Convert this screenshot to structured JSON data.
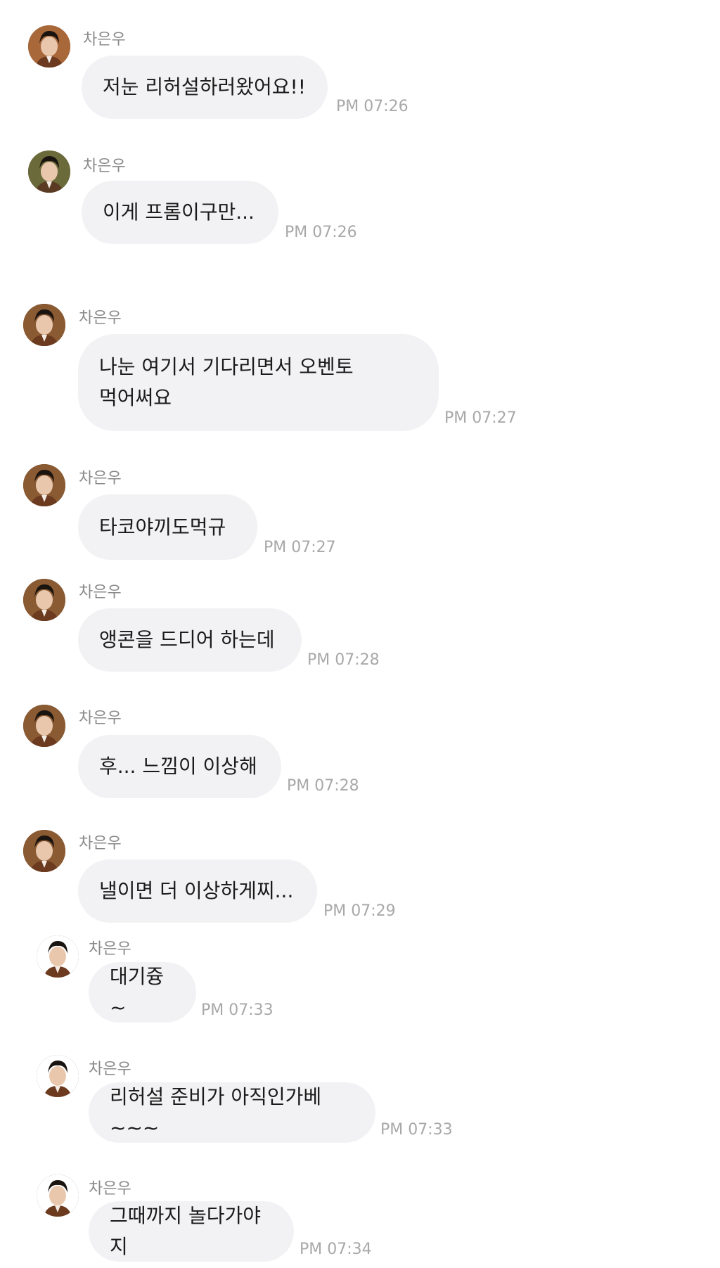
{
  "sender": "차은우",
  "avatar_icon": "profile-photo",
  "colors": {
    "bubble": "#f2f2f4",
    "name": "#8a8a8a",
    "time": "#a8a8a8",
    "text": "#1a1a1a"
  },
  "messages": [
    {
      "name": "차은우",
      "text": "저눈 리허설하러왔어요!!",
      "time": "PM 07:26"
    },
    {
      "name": "차은우",
      "text": "이게 프롬이구만...",
      "time": "PM 07:26"
    },
    {
      "name": "차은우",
      "text": "나눈 여기서 기다리면서 오벤토\n먹어써요",
      "time": "PM 07:27"
    },
    {
      "name": "차은우",
      "text": "타코야끼도먹규",
      "time": "PM 07:27"
    },
    {
      "name": "차은우",
      "text": "앵콘을 드디어 하는데",
      "time": "PM 07:28"
    },
    {
      "name": "차은우",
      "text": "후... 느낌이 이상해",
      "time": "PM 07:28"
    },
    {
      "name": "차은우",
      "text": "낼이면 더 이상하게찌...",
      "time": "PM 07:29"
    },
    {
      "name": "차은우",
      "text": "대기즁~",
      "time": "PM 07:33"
    },
    {
      "name": "차은우",
      "text": "리허설 준비가 아직인가베~~~",
      "time": "PM 07:33"
    },
    {
      "name": "차은우",
      "text": "그때까지 놀다가야지",
      "time": "PM 07:34"
    }
  ]
}
